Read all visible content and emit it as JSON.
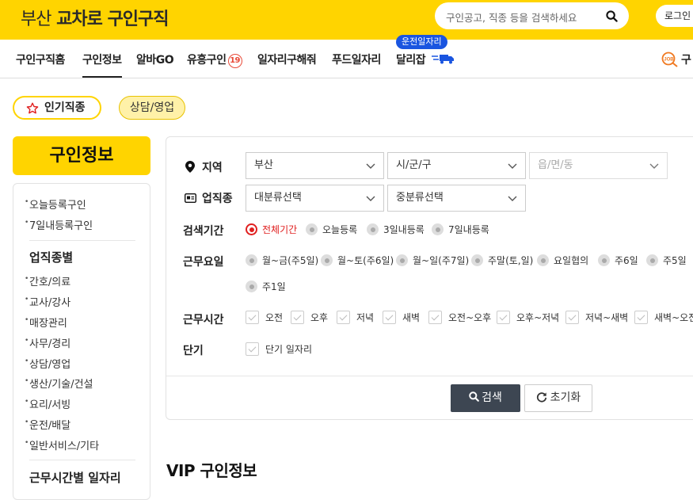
{
  "header": {
    "logo_prefix": "부산",
    "logo_brand": "교차로",
    "logo_suffix": "구인구직",
    "search_placeholder": "구인공고, 직종 등을 검색하세요",
    "login_label": "로그인",
    "accent_color": "#ffd400"
  },
  "nav": {
    "items": [
      "구인구직홈",
      "구인정보",
      "알바GO",
      "유흥구인",
      "일자리구해줘",
      "푸드일자리",
      "달리잡"
    ],
    "badge_19": "19",
    "dalijob_bubble": "운전일자리",
    "right_partial": "구"
  },
  "chips": {
    "popular": "인기직종",
    "selected": "상담/영업"
  },
  "sidebar": {
    "title": "구인정보",
    "recent": [
      "오늘등록구인",
      "7일내등록구인"
    ],
    "category_heading": "업직종별",
    "categories": [
      "간호/의료",
      "교사/강사",
      "매장관리",
      "사무/경리",
      "상담/영업",
      "생산/기술/건설",
      "요리/서빙",
      "운전/배달",
      "일반서비스/기타"
    ],
    "time_heading": "근무시간별 일자리"
  },
  "filters": {
    "region": {
      "label": "지역",
      "city": "부산",
      "district": "시/군/구",
      "dong_placeholder": "읍/면/동"
    },
    "industry": {
      "label": "업직종",
      "major": "대분류선택",
      "minor": "중분류선택"
    },
    "period": {
      "label": "검색기간",
      "options": [
        "전체기간",
        "오늘등록",
        "3일내등록",
        "7일내등록"
      ],
      "selected": "전체기간"
    },
    "workdays": {
      "label": "근무요일",
      "options": [
        "월~금(주5일)",
        "월~토(주6일)",
        "월~일(주7일)",
        "주말(토,일)",
        "요일협의",
        "주6일",
        "주5일",
        "주1일"
      ]
    },
    "worktime": {
      "label": "근무시간",
      "options": [
        "오전",
        "오후",
        "저녁",
        "새벽",
        "오전~오후",
        "오후~저녁",
        "저녁~새벽",
        "새벽~오전"
      ]
    },
    "shortterm": {
      "label": "단기",
      "option": "단기 일자리"
    },
    "search_button": "검색",
    "reset_button": "초기화"
  },
  "vip_heading": "VIP 구인정보"
}
